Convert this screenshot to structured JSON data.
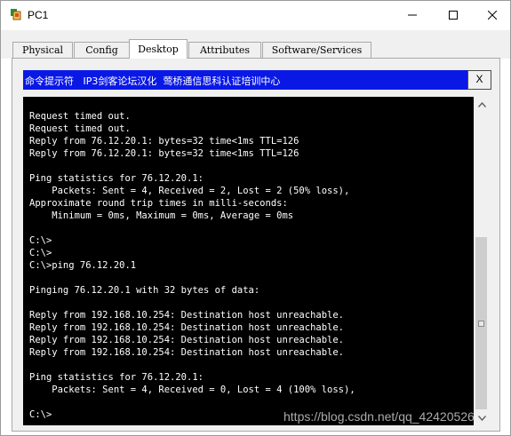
{
  "window": {
    "title": "PC1",
    "controls": {
      "minimize_icon": "minimize-icon",
      "maximize_icon": "maximize-icon",
      "close_icon": "close-icon"
    }
  },
  "tabs": [
    {
      "label": "Physical",
      "active": false
    },
    {
      "label": "Config",
      "active": false
    },
    {
      "label": "Desktop",
      "active": true
    },
    {
      "label": "Attributes",
      "active": false
    },
    {
      "label": "Software/Services",
      "active": false
    }
  ],
  "command_prompt": {
    "caption": "命令提示符   IP3剑客论坛汉化  莺桥通信思科认证培训中心",
    "close_label": "X",
    "caption_color": "#0a18e6"
  },
  "terminal": {
    "lines": [
      "Request timed out.",
      "Request timed out.",
      "Reply from 76.12.20.1: bytes=32 time<1ms TTL=126",
      "Reply from 76.12.20.1: bytes=32 time<1ms TTL=126",
      "",
      "Ping statistics for 76.12.20.1:",
      "    Packets: Sent = 4, Received = 2, Lost = 2 (50% loss),",
      "Approximate round trip times in milli-seconds:",
      "    Minimum = 0ms, Maximum = 0ms, Average = 0ms",
      "",
      "C:\\>",
      "C:\\>",
      "C:\\>ping 76.12.20.1",
      "",
      "Pinging 76.12.20.1 with 32 bytes of data:",
      "",
      "Reply from 192.168.10.254: Destination host unreachable.",
      "Reply from 192.168.10.254: Destination host unreachable.",
      "Reply from 192.168.10.254: Destination host unreachable.",
      "Reply from 192.168.10.254: Destination host unreachable.",
      "",
      "Ping statistics for 76.12.20.1:",
      "    Packets: Sent = 4, Received = 0, Lost = 4 (100% loss),",
      "",
      "C:\\>"
    ]
  },
  "watermark": "https://blog.csdn.net/qq_42420526"
}
